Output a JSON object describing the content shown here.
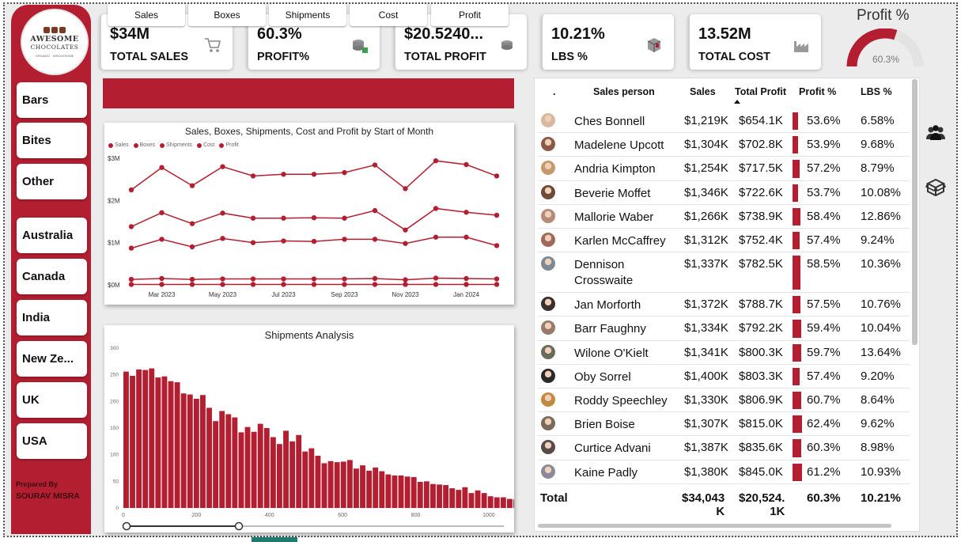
{
  "logo": {
    "line1": "AWESOME",
    "line2": "CHOCOLATES",
    "line3": "ORGANIC · WHOLESOME"
  },
  "sidebar": {
    "items": [
      {
        "label": "Bars"
      },
      {
        "label": "Bites"
      },
      {
        "label": "Other"
      },
      {
        "label": "Australia"
      },
      {
        "label": "Canada"
      },
      {
        "label": "India"
      },
      {
        "label": "New Ze..."
      },
      {
        "label": "UK"
      },
      {
        "label": "USA"
      }
    ],
    "prepared_by": "Prepared By",
    "author": "SOURAV MISRA"
  },
  "kpis": [
    {
      "value": "$34M",
      "label": "TOTAL SALES",
      "icon": "shopping-cart-icon"
    },
    {
      "value": "60.3%",
      "label": "PROFIT%",
      "icon": "coins-icon"
    },
    {
      "value": "$20.5240...",
      "label": "TOTAL PROFIT",
      "icon": "coin-stack-icon"
    },
    {
      "value": "10.21%",
      "label": "LBS %",
      "icon": "box-icon"
    },
    {
      "value": "13.52M",
      "label": "TOTAL COST",
      "icon": "factory-icon"
    }
  ],
  "gauge": {
    "title": "Profit %",
    "value_label": "60.3%",
    "value": 0.603
  },
  "tabs": [
    {
      "label": "Sales"
    },
    {
      "label": "Boxes"
    },
    {
      "label": "Shipments"
    },
    {
      "label": "Cost"
    },
    {
      "label": "Profit"
    }
  ],
  "colors": {
    "accent": "#b31f31",
    "teal": "#1e7b6e"
  },
  "chart_data": [
    {
      "type": "line",
      "title": "Sales, Boxes, Shipments, Cost and Profit by Start of Month",
      "legend": [
        "Sales",
        "Boxes",
        "Shipments",
        "Cost",
        "Profit"
      ],
      "legend_position": "top-left",
      "x_tick_labels": [
        "Mar 2023",
        "May 2023",
        "Jul 2023",
        "Sep 2023",
        "Nov 2023",
        "Jan 2024"
      ],
      "y_tick_labels": [
        "$3M",
        "$2M",
        "$1M",
        "$0M"
      ],
      "ylim": [
        0,
        3.0
      ],
      "x": [
        "Feb 2023",
        "Mar 2023",
        "Apr 2023",
        "May 2023",
        "Jun 2023",
        "Jul 2023",
        "Aug 2023",
        "Sep 2023",
        "Oct 2023",
        "Nov 2023",
        "Dec 2023",
        "Jan 2024",
        "Feb 2024"
      ],
      "series": [
        {
          "name": "Sales",
          "values": [
            2.25,
            2.78,
            2.35,
            2.8,
            2.58,
            2.62,
            2.62,
            2.66,
            2.84,
            2.28,
            2.94,
            2.85,
            2.58
          ]
        },
        {
          "name": "Boxes",
          "values": [
            0.13,
            0.15,
            0.13,
            0.14,
            0.14,
            0.14,
            0.14,
            0.14,
            0.15,
            0.12,
            0.16,
            0.15,
            0.14
          ]
        },
        {
          "name": "Shipments",
          "values": [
            0.01,
            0.01,
            0.01,
            0.01,
            0.01,
            0.01,
            0.01,
            0.01,
            0.01,
            0.01,
            0.01,
            0.01,
            0.01
          ]
        },
        {
          "name": "Cost",
          "values": [
            0.87,
            1.08,
            0.9,
            1.1,
            1.0,
            1.04,
            1.03,
            1.08,
            1.08,
            0.98,
            1.13,
            1.13,
            0.93
          ]
        },
        {
          "name": "Profit",
          "values": [
            1.38,
            1.71,
            1.45,
            1.7,
            1.58,
            1.58,
            1.59,
            1.58,
            1.76,
            1.3,
            1.81,
            1.72,
            1.65
          ]
        }
      ],
      "grid": false
    },
    {
      "type": "bar",
      "title": "Shipments Analysis",
      "x_tick_labels": [
        "0",
        "200",
        "400",
        "600",
        "800",
        "1000"
      ],
      "y_tick_labels": [
        "300",
        "250",
        "200",
        "150",
        "100",
        "50",
        "0"
      ],
      "xlim": [
        0,
        1050
      ],
      "ylim": [
        0,
        300
      ],
      "bin_width": 17.5,
      "values": [
        256,
        248,
        260,
        259,
        262,
        245,
        247,
        238,
        236,
        215,
        213,
        205,
        212,
        188,
        163,
        182,
        176,
        170,
        142,
        152,
        143,
        158,
        150,
        133,
        120,
        145,
        125,
        137,
        106,
        112,
        98,
        84,
        88,
        86,
        87,
        90,
        74,
        80,
        70,
        76,
        69,
        63,
        61,
        61,
        59,
        58,
        49,
        50,
        45,
        44,
        43,
        37,
        34,
        39,
        28,
        33,
        28,
        22,
        20,
        20,
        17,
        16,
        12,
        11,
        11,
        7
      ],
      "grid": false
    }
  ],
  "table": {
    "headers": {
      "dot": ".",
      "person": "Sales person",
      "sales": "Sales",
      "profit": "Total Profit",
      "profit_pct": "Profit %",
      "lbs": "LBS %"
    },
    "rows": [
      {
        "name": "Ches Bonnell",
        "sales": "$1,219K",
        "profit": "$654.1K",
        "pct": "53.6%",
        "pct_value": 0.536,
        "lbs": "6.58%"
      },
      {
        "name": "Madelene Upcott",
        "sales": "$1,304K",
        "profit": "$702.8K",
        "pct": "53.9%",
        "pct_value": 0.539,
        "lbs": "9.68%"
      },
      {
        "name": "Andria Kimpton",
        "sales": "$1,254K",
        "profit": "$717.5K",
        "pct": "57.2%",
        "pct_value": 0.572,
        "lbs": "8.79%"
      },
      {
        "name": "Beverie Moffet",
        "sales": "$1,346K",
        "profit": "$722.6K",
        "pct": "53.7%",
        "pct_value": 0.537,
        "lbs": "10.08%"
      },
      {
        "name": "Mallorie Waber",
        "sales": "$1,266K",
        "profit": "$738.9K",
        "pct": "58.4%",
        "pct_value": 0.584,
        "lbs": "12.86%"
      },
      {
        "name": "Karlen McCaffrey",
        "sales": "$1,312K",
        "profit": "$752.4K",
        "pct": "57.4%",
        "pct_value": 0.574,
        "lbs": "9.24%"
      },
      {
        "name": "Dennison Crosswaite",
        "sales": "$1,337K",
        "profit": "$782.5K",
        "pct": "58.5%",
        "pct_value": 0.585,
        "lbs": "10.36%"
      },
      {
        "name": "Jan Morforth",
        "sales": "$1,372K",
        "profit": "$788.7K",
        "pct": "57.5%",
        "pct_value": 0.575,
        "lbs": "10.76%"
      },
      {
        "name": "Barr Faughny",
        "sales": "$1,334K",
        "profit": "$792.2K",
        "pct": "59.4%",
        "pct_value": 0.594,
        "lbs": "10.04%"
      },
      {
        "name": "Wilone O'Kielt",
        "sales": "$1,341K",
        "profit": "$800.3K",
        "pct": "59.7%",
        "pct_value": 0.597,
        "lbs": "13.64%"
      },
      {
        "name": "Oby Sorrel",
        "sales": "$1,400K",
        "profit": "$803.3K",
        "pct": "57.4%",
        "pct_value": 0.574,
        "lbs": "9.20%"
      },
      {
        "name": "Roddy Speechley",
        "sales": "$1,330K",
        "profit": "$806.9K",
        "pct": "60.7%",
        "pct_value": 0.607,
        "lbs": "8.64%"
      },
      {
        "name": "Brien Boise",
        "sales": "$1,307K",
        "profit": "$815.0K",
        "pct": "62.4%",
        "pct_value": 0.624,
        "lbs": "9.62%"
      },
      {
        "name": "Curtice Advani",
        "sales": "$1,387K",
        "profit": "$835.6K",
        "pct": "60.3%",
        "pct_value": 0.603,
        "lbs": "8.98%"
      },
      {
        "name": "Kaine Padly",
        "sales": "$1,380K",
        "profit": "$845.0K",
        "pct": "61.2%",
        "pct_value": 0.612,
        "lbs": "10.93%"
      }
    ],
    "total": {
      "label": "Total",
      "sales_l1": "$34,043",
      "sales_l2": "K",
      "profit_l1": "$20,524.",
      "profit_l2": "1K",
      "pct": "60.3%",
      "lbs": "10.21%"
    }
  }
}
